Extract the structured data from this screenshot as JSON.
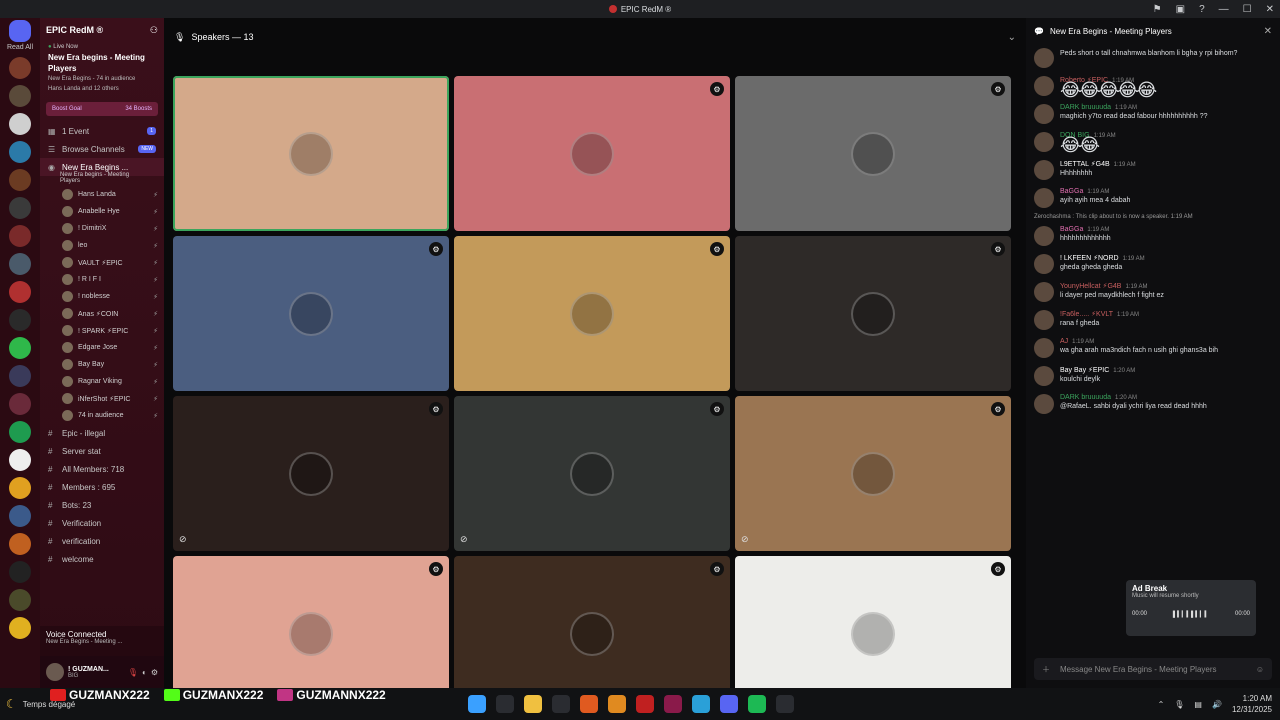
{
  "window": {
    "title": "EPIC RedM ®"
  },
  "sidebar": {
    "server_name": "EPIC RedM ®",
    "live": "Live Now",
    "event_title": "New Era begins - Meeting Players",
    "event_meta1": "New Era Begins - 74 in audience",
    "event_meta2": "Hans Landa and 12 others",
    "boost_goal": "Boost Goal",
    "boosts": "34 Boosts",
    "events": "1 Event",
    "events_count": "1",
    "browse": "Browse Channels",
    "browse_badge": "NEW",
    "voice_channel": "New Era Begins ...",
    "voice_channel_sub": "New Era begins - Meeting Players",
    "members": [
      {
        "name": "Hans Landa"
      },
      {
        "name": "Anabelle Hye"
      },
      {
        "name": "! DimitriX"
      },
      {
        "name": "leo"
      },
      {
        "name": "VAULT ⚡EPIC"
      },
      {
        "name": "! R I F I"
      },
      {
        "name": "! noblesse"
      },
      {
        "name": "Anas ⚡COIN"
      },
      {
        "name": "! SPARK ⚡EPIC"
      },
      {
        "name": "Edgare Jose"
      },
      {
        "name": "Bay Bay"
      },
      {
        "name": "Ragnar Viking"
      },
      {
        "name": "iNferShot ⚡EPIC"
      },
      {
        "name": "74 in audience"
      }
    ],
    "channels": [
      {
        "name": "Epic - illegal"
      },
      {
        "name": "Server stat"
      },
      {
        "name": "All Members: 718"
      },
      {
        "name": "Members : 695"
      },
      {
        "name": "Bots: 23"
      },
      {
        "name": "Verification"
      },
      {
        "name": "verification"
      },
      {
        "name": "welcome"
      }
    ],
    "voice_connected": "Voice Connected",
    "voice_sub": "New Era Begins - Meeting ...",
    "user_name": "! GUZMAN...",
    "user_status": "BIG"
  },
  "stage": {
    "speakers_label": "Speakers — 13",
    "tiles": [
      {
        "name": "tile-1",
        "bg": "#d4a98a",
        "speaking": true
      },
      {
        "name": "tile-2",
        "bg": "#c96f73"
      },
      {
        "name": "tile-3",
        "bg": "#6b6b6b"
      },
      {
        "name": "tile-4",
        "bg": "#4b5e80"
      },
      {
        "name": "tile-5",
        "bg": "#c39a5a"
      },
      {
        "name": "tile-6",
        "bg": "#2e2a28"
      },
      {
        "name": "tile-7",
        "bg": "#2a1f1c",
        "muted": true
      },
      {
        "name": "tile-8",
        "bg": "#333634",
        "muted": true
      },
      {
        "name": "tile-9",
        "bg": "#9a7552",
        "muted": true
      },
      {
        "name": "tile-10",
        "bg": "#e0a393"
      },
      {
        "name": "tile-11",
        "bg": "#3e2c20"
      },
      {
        "name": "tile-12",
        "bg": "#ededea"
      }
    ]
  },
  "chat": {
    "title": "New Era Begins - Meeting Players",
    "messages": [
      {
        "name": "",
        "time": "",
        "text": "Peds short o tall chnahmwa blanhom li bgha y rpi bihom?",
        "color": "#dbdee1"
      },
      {
        "name": "Roberto ⚡EPIC",
        "time": "1:19 AM",
        "text": "😂😂😂😂😂",
        "emoji": true,
        "color": "#c85f5f"
      },
      {
        "name": "DARK bruuuuda",
        "time": "1:19 AM",
        "text": "maghich y7to read dead fabour hhhhhhhhhh ??",
        "color": "#3ba55d"
      },
      {
        "name": "DON BIG",
        "time": "1:19 AM",
        "text": "😂😂",
        "emoji": true,
        "color": "#3ba55d"
      },
      {
        "name": "L9ETTAL ⚡G4B",
        "time": "1:19 AM",
        "text": "Hhhhhhhh",
        "color": "#ffffff"
      },
      {
        "name": "BaGGa",
        "time": "1:19 AM",
        "text": "ayih ayih mea 4 dabah",
        "color": "#e26fb0"
      },
      {
        "name": "BaGGa",
        "time": "1:19 AM",
        "text": "hhhhhhhhhhhhh",
        "color": "#e26fb0"
      },
      {
        "name": "! LKFEEN ⚡NORD",
        "time": "1:19 AM",
        "text": "gheda gheda gheda",
        "color": "#ffffff"
      },
      {
        "name": "YounyHellcat ⚡G4B",
        "time": "1:19 AM",
        "text": "li dayer ped maydkhlech f fight ez",
        "color": "#c85f5f"
      },
      {
        "name": "!Fa6le..... ⚡KVLT",
        "time": "1:19 AM",
        "text": "rana f gheda",
        "color": "#c85f5f"
      },
      {
        "name": "AJ",
        "time": "1:19 AM",
        "text": "wa gha arah ma3ndich fach n usih ghi ghans3a bih",
        "color": "#c85f5f"
      },
      {
        "name": "Bay Bay ⚡EPIC",
        "time": "1:20 AM",
        "text": "koulchi deylk",
        "color": "#ffffff"
      },
      {
        "name": "DARK bruuuuda",
        "time": "1:20 AM",
        "text": "@RafaeL. sahbi dyali ychri liya read dead hhhh",
        "color": "#3ba55d"
      }
    ],
    "system": "Zerochashma : This clip about to is now a speaker. 1:19 AM",
    "ad_title": "Ad Break",
    "ad_sub": "Music will resume shortly",
    "ad_t1": "00:00",
    "ad_t2": "00:00",
    "input_placeholder": "Message New Era Begins - Meeting Players"
  },
  "taskbar": {
    "weather": "Temps dégagé",
    "youtube": "GUZMANX222",
    "kick": "GUZMANX222",
    "instagram": "GUZMANNX222",
    "time": "1:20 AM",
    "date": "12/31/2025"
  }
}
